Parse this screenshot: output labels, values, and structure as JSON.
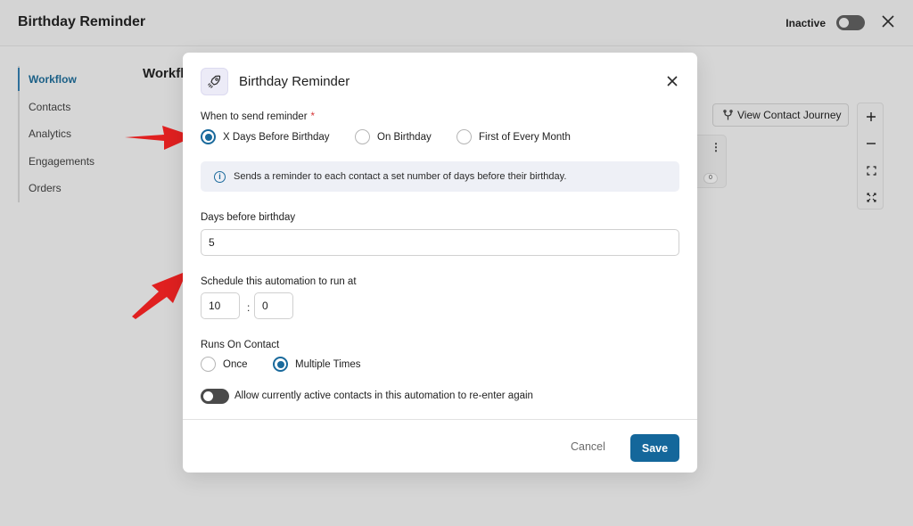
{
  "header": {
    "title": "Birthday Reminder",
    "status_label": "Inactive"
  },
  "sidebar": {
    "items": [
      {
        "label": "Workflow",
        "active": true
      },
      {
        "label": "Contacts"
      },
      {
        "label": "Analytics"
      },
      {
        "label": "Engagements"
      },
      {
        "label": "Orders"
      }
    ]
  },
  "main": {
    "heading": "Workfl"
  },
  "canvas": {
    "view_journey_label": "View Contact Journey",
    "node_count": "0"
  },
  "modal": {
    "title": "Birthday Reminder",
    "when_label": "When to send reminder",
    "required_mark": "*",
    "when_options": [
      {
        "label": "X Days Before Birthday",
        "checked": true
      },
      {
        "label": "On Birthday"
      },
      {
        "label": "First of Every Month"
      }
    ],
    "info_text": "Sends a reminder to each contact a set number of days before their birthday.",
    "days_label": "Days before birthday",
    "days_value": "5",
    "schedule_label": "Schedule this automation to run at",
    "hour_value": "10",
    "minute_value": "0",
    "time_separator": ":",
    "runs_label": "Runs On Contact",
    "runs_options": [
      {
        "label": "Once"
      },
      {
        "label": "Multiple Times",
        "checked": true
      }
    ],
    "reenter_label": "Allow currently active contacts in this automation to re-enter again",
    "cancel_label": "Cancel",
    "save_label": "Save"
  },
  "colors": {
    "accent": "#14679b",
    "annotation_arrow": "#e02020",
    "required": "#d63638"
  }
}
